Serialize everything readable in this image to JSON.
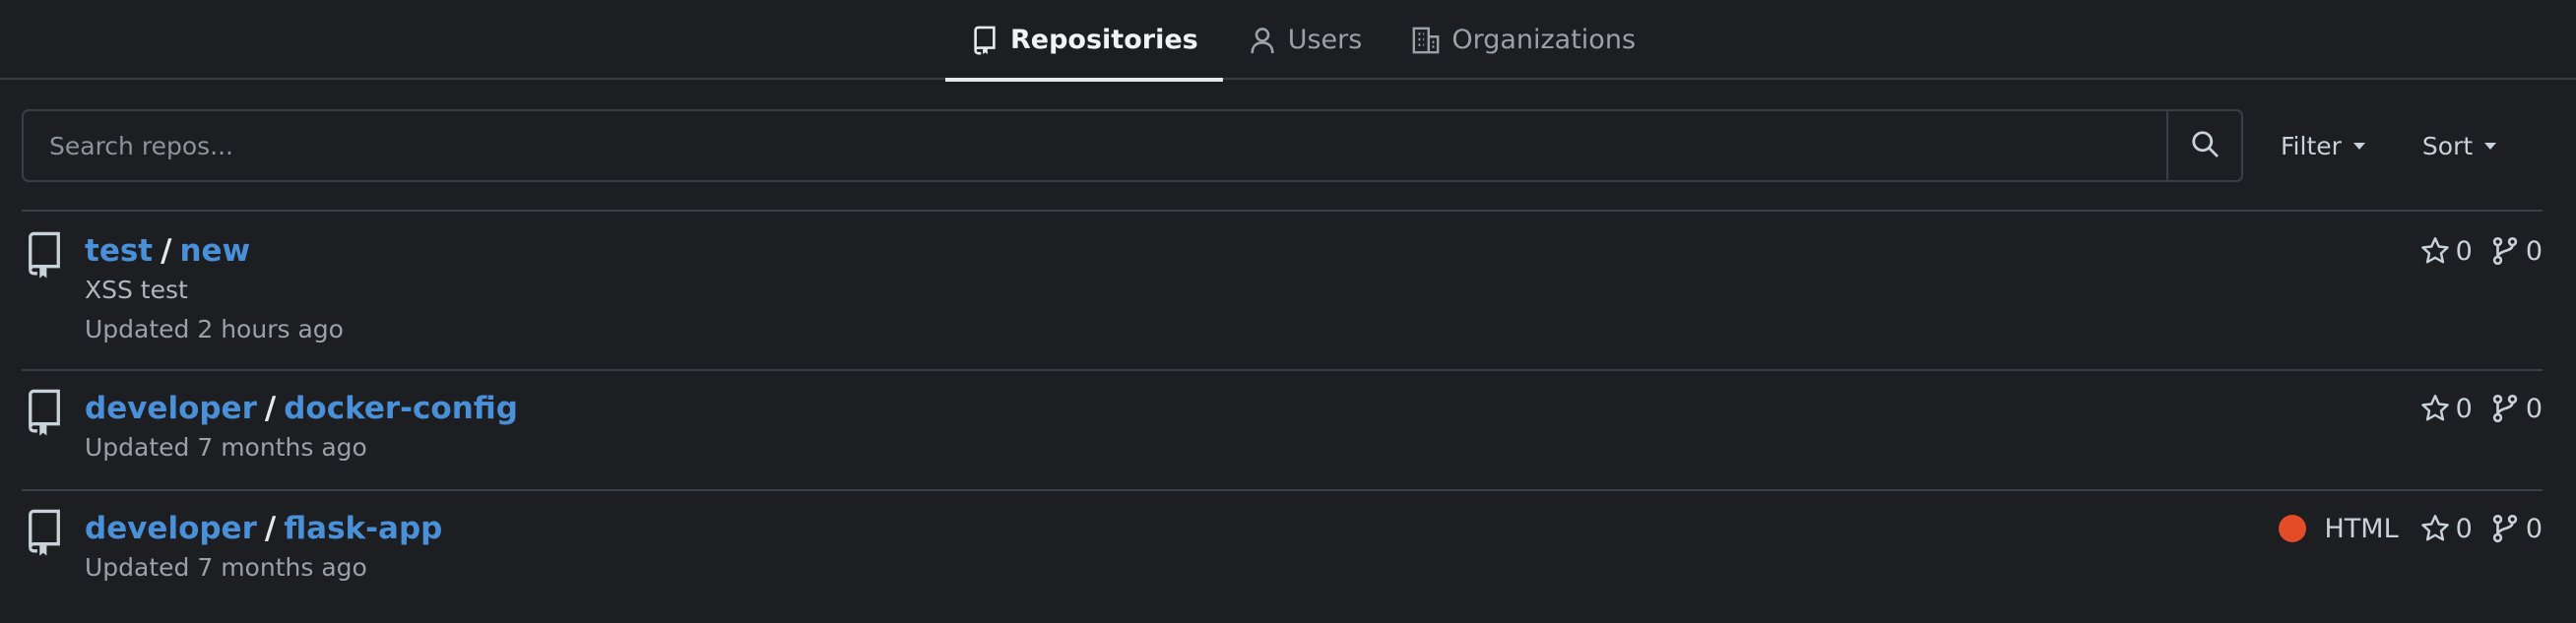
{
  "tabs": [
    {
      "label": "Repositories",
      "icon": "repo-icon",
      "active": true
    },
    {
      "label": "Users",
      "icon": "user-icon",
      "active": false
    },
    {
      "label": "Organizations",
      "icon": "organization-icon",
      "active": false
    }
  ],
  "search": {
    "placeholder": "Search repos...",
    "value": ""
  },
  "filter": {
    "label": "Filter"
  },
  "sort": {
    "label": "Sort"
  },
  "repos": [
    {
      "owner": "test",
      "name": "new",
      "description": "XSS test",
      "updated": "Updated 2 hours ago",
      "language": "",
      "stars": "0",
      "forks": "0"
    },
    {
      "owner": "developer",
      "name": "docker-config",
      "description": "",
      "updated": "Updated 7 months ago",
      "language": "",
      "stars": "0",
      "forks": "0"
    },
    {
      "owner": "developer",
      "name": "flask-app",
      "description": "",
      "updated": "Updated 7 months ago",
      "language": "HTML",
      "language_color": "#e34c26",
      "stars": "0",
      "forks": "0"
    }
  ],
  "colors": {
    "background": "#1c1e22",
    "link": "#4a90d9",
    "border": "#3a3f46"
  }
}
